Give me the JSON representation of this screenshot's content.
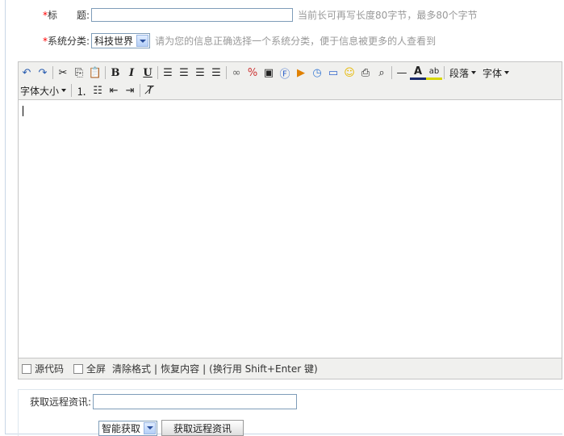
{
  "form": {
    "title_label": "标　　题:",
    "title_value": "",
    "title_hint": "当前长可再写长度80字节，最多80个字节",
    "category_label": "系统分类:",
    "category_selected": "科技世界",
    "category_hint": "请为您的信息正确选择一个系统分类，便于信息被更多的人查看到",
    "required_mark": "*"
  },
  "toolbar": {
    "row1": [
      "undo-icon",
      "redo-icon",
      "cut-icon",
      "copy-icon",
      "paste-icon",
      "bold-icon",
      "italic-icon",
      "underline-icon",
      "align-left-icon",
      "align-center-icon",
      "align-right-icon",
      "align-justify-icon",
      "link-icon",
      "unlink-icon",
      "image-icon",
      "flash-icon",
      "media-icon",
      "clock-icon",
      "table-icon",
      "emoticon-icon",
      "code-icon",
      "search-icon",
      "horizontal-rule-icon",
      "font-color-icon",
      "highlight-icon"
    ],
    "paragraph_label": "段落",
    "font_label": "字体",
    "font_size_label": "字体大小",
    "row2": [
      "ordered-list-icon",
      "unordered-list-icon",
      "outdent-icon",
      "indent-icon",
      "remove-format-icon"
    ]
  },
  "statusbar": {
    "source_label": "源代码",
    "fullscreen_label": "全屏",
    "clear_format": "清除格式",
    "restore": "恢复内容",
    "newline_hint": "(换行用  Shift+Enter 键)",
    "divider": "|"
  },
  "remote": {
    "label": "获取远程资讯:",
    "value": "",
    "mode_selected": "智能获取",
    "button_label": "获取远程资讯"
  }
}
